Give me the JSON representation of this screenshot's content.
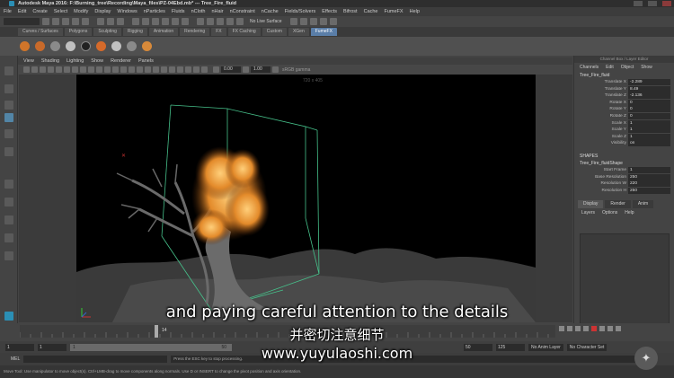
{
  "window": {
    "title": "Autodesk Maya 2016: F:\\Burning_tree\\Recording\\Maya_files\\PZ-04Ebd.mb*  ---  Tree_Fire_fluid"
  },
  "menubar": [
    "File",
    "Edit",
    "Create",
    "Select",
    "Modify",
    "Display",
    "Windows",
    "nParticles",
    "Fluids",
    "nCloth",
    "nHair",
    "nConstraint",
    "nCache",
    "Fields/Solvers",
    "Effects",
    "Bifrost",
    "Cache",
    "FumeFX",
    "Help"
  ],
  "status_line": {
    "live_surface": "No Live Surface"
  },
  "shelf_tabs": [
    {
      "label": "Curves / Surfaces",
      "active": false
    },
    {
      "label": "Polygons",
      "active": false
    },
    {
      "label": "Sculpting",
      "active": false
    },
    {
      "label": "Rigging",
      "active": false
    },
    {
      "label": "Animation",
      "active": false
    },
    {
      "label": "Rendering",
      "active": false
    },
    {
      "label": "FX",
      "active": false
    },
    {
      "label": "FX Caching",
      "active": false
    },
    {
      "label": "Custom",
      "active": false
    },
    {
      "label": "XGen",
      "active": false
    },
    {
      "label": "FumeFX",
      "active": true
    }
  ],
  "viewport": {
    "menu": [
      "View",
      "Shading",
      "Lighting",
      "Show",
      "Renderer",
      "Panels"
    ],
    "field_a": "0.00",
    "field_b": "1.00",
    "color_space": "sRGB gamma",
    "camera_label": "720 x 405"
  },
  "channel_box": {
    "title": "Channel Box / Layer Editor",
    "menu": [
      "Channels",
      "Edit",
      "Object",
      "Show"
    ],
    "object": "Tree_Fire_fluid",
    "attributes": [
      {
        "name": "Translate X",
        "value": "-2.289"
      },
      {
        "name": "Translate Y",
        "value": "8.49"
      },
      {
        "name": "Translate Z",
        "value": "-2.136"
      },
      {
        "name": "Rotate X",
        "value": "0"
      },
      {
        "name": "Rotate Y",
        "value": "0"
      },
      {
        "name": "Rotate Z",
        "value": "0"
      },
      {
        "name": "Scale X",
        "value": "1"
      },
      {
        "name": "Scale Y",
        "value": "1"
      },
      {
        "name": "Scale Z",
        "value": "1"
      },
      {
        "name": "Visibility",
        "value": "on"
      }
    ],
    "shapes_header": "SHAPES",
    "shape_name": "Tree_Fire_fluidShape",
    "shape_attributes": [
      {
        "name": "Start Frame",
        "value": "1"
      },
      {
        "name": "Base Resolution",
        "value": "250"
      },
      {
        "name": "Resolution W",
        "value": "220"
      },
      {
        "name": "Resolution H",
        "value": "250"
      }
    ],
    "layer_tabs": [
      {
        "label": "Display",
        "active": true
      },
      {
        "label": "Render",
        "active": false
      },
      {
        "label": "Anim",
        "active": false
      }
    ],
    "layer_menu": [
      "Layers",
      "Options",
      "Help"
    ]
  },
  "timeline": {
    "current_frame": "14"
  },
  "range": {
    "start": "1",
    "start2": "1",
    "slider_start": "1",
    "slider_end": "50",
    "end": "50",
    "end2": "125",
    "anim_layer": "No Anim Layer",
    "character_set": "No Character Set"
  },
  "command_line": {
    "label": "MEL",
    "output": "Press the ESC key to stop  processing."
  },
  "help_line": "Move Tool: Use manipulator to move object(s). Ctrl+LMB-drag to move components along normals. Use D or INSERT to change the pivot position and axis orientation.",
  "subtitles": {
    "english": "and paying careful attention to the details",
    "chinese": "并密切注意细节",
    "watermark": "www.yuyulaoshi.com"
  },
  "colors": {
    "accent": "#5a7ea8",
    "fire_orange": "#e8902a"
  }
}
